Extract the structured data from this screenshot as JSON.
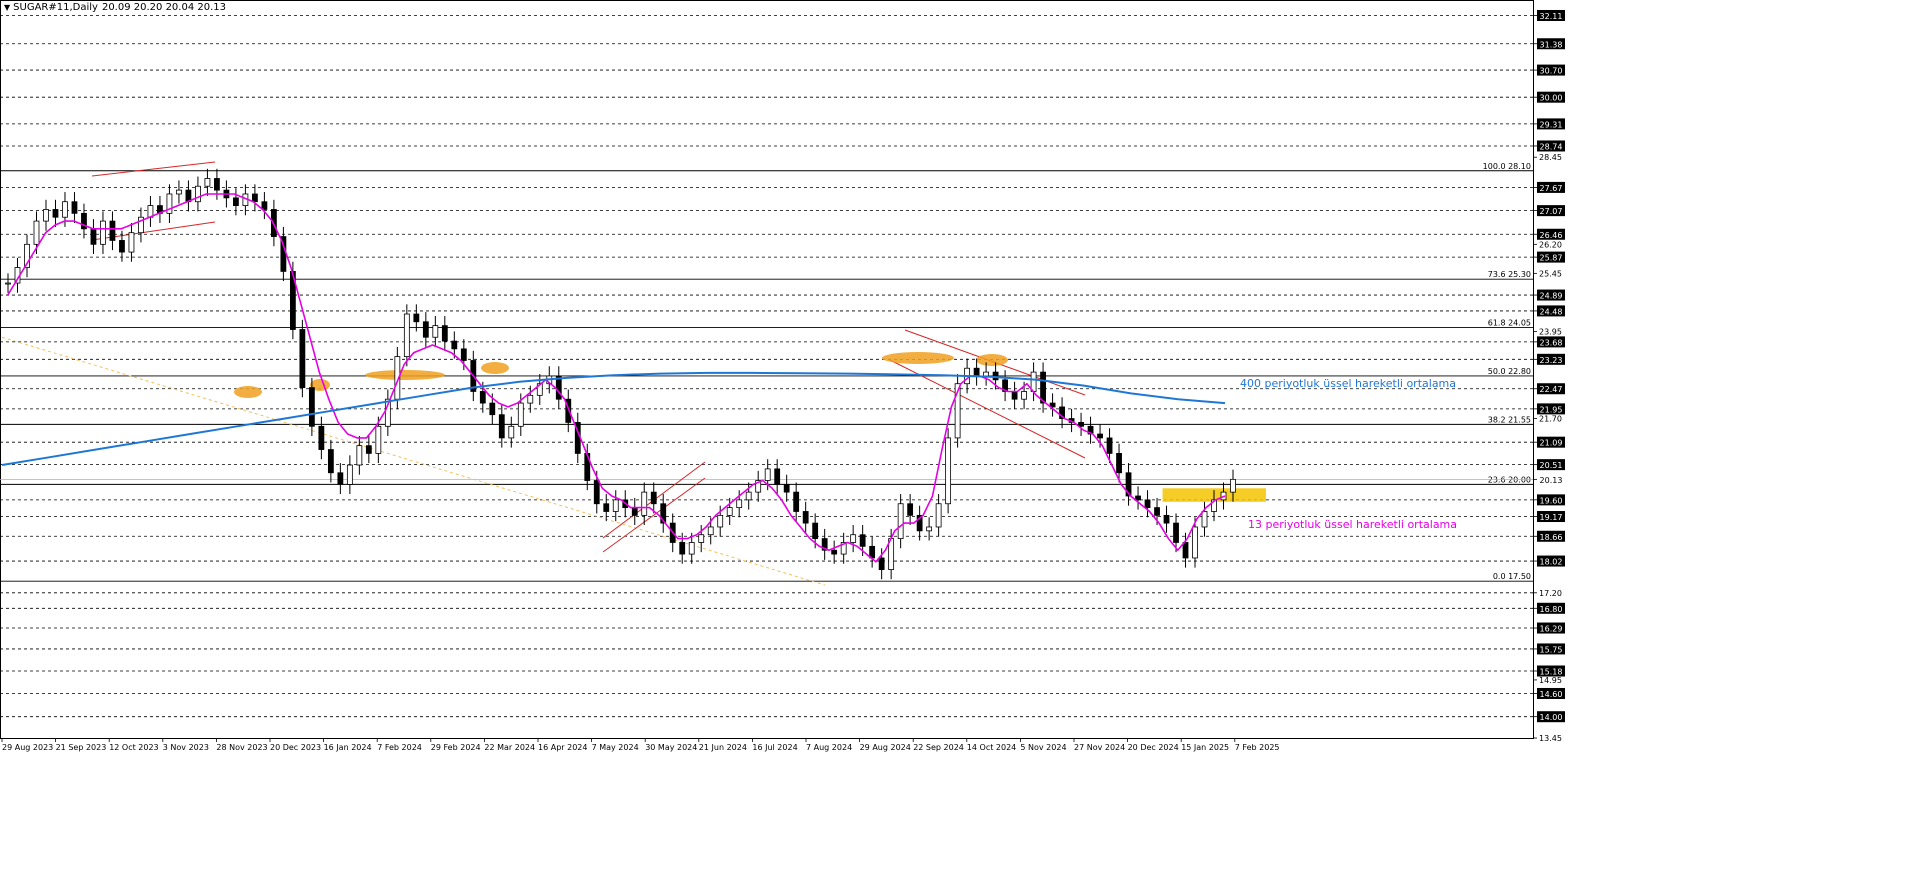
{
  "header": {
    "symbol": "SUGAR#11,Daily",
    "ohlc": "20.09 20.20 20.04 20.13"
  },
  "chart_data": {
    "type": "candlestick",
    "title": "SUGAR#11,Daily",
    "ylim": [
      13.45,
      32.2
    ],
    "y_ticks": [
      "32.11",
      "31.38",
      "30.70",
      "30.00",
      "29.31",
      "28.74",
      "28.45",
      "27.67",
      "27.07",
      "26.46",
      "26.20",
      "25.87",
      "25.45",
      "24.89",
      "24.48",
      "23.95",
      "23.68",
      "23.23",
      "22.47",
      "21.95",
      "21.70",
      "21.09",
      "20.51",
      "20.13",
      "19.60",
      "19.17",
      "18.66",
      "18.02",
      "17.20",
      "16.80",
      "16.29",
      "15.75",
      "15.18",
      "14.95",
      "14.60",
      "14.00",
      "13.45"
    ],
    "highlighted_levels": [
      32.11,
      31.38,
      30.7,
      30.0,
      29.31,
      28.74,
      27.67,
      27.07,
      26.46,
      25.87,
      24.89,
      24.48,
      23.68,
      23.23,
      22.47,
      21.95,
      21.09,
      20.51,
      20.13,
      19.6,
      19.17,
      18.66,
      18.02,
      16.8,
      16.29,
      15.75,
      15.18,
      14.6,
      14.0
    ],
    "plain_levels": [
      28.45,
      26.2,
      25.45,
      23.95,
      21.7,
      17.2,
      13.45
    ],
    "current_price": 20.13,
    "x_labels": [
      "29 Aug 2023",
      "21 Sep 2023",
      "12 Oct 2023",
      "3 Nov 2023",
      "28 Nov 2023",
      "20 Dec 2023",
      "16 Jan 2024",
      "7 Feb 2024",
      "29 Feb 2024",
      "22 Mar 2024",
      "16 Apr 2024",
      "7 May 2024",
      "30 May 2024",
      "21 Jun 2024",
      "16 Jul 2024",
      "7 Aug 2024",
      "29 Aug 2024",
      "22 Sep 2024",
      "14 Oct 2024",
      "5 Nov 2024",
      "27 Nov 2024",
      "20 Dec 2024",
      "15 Jan 2025",
      "7 Feb 2025"
    ],
    "dashed_levels": [
      32.11,
      31.38,
      30.7,
      30.0,
      29.31,
      28.74,
      27.67,
      27.07,
      26.46,
      25.87,
      24.89,
      24.48,
      23.68,
      23.23,
      22.47,
      21.95,
      21.09,
      20.51,
      19.6,
      19.17,
      18.66,
      18.02,
      17.2,
      16.8,
      16.29,
      15.75,
      15.18,
      14.6,
      14.0
    ],
    "fibonacci": [
      {
        "label": "100.0 28.10",
        "value": 28.1
      },
      {
        "label": "73.6 25.30",
        "value": 25.3
      },
      {
        "label": "61.8 24.05",
        "value": 24.05
      },
      {
        "label": "50.0 22.80",
        "value": 22.8
      },
      {
        "label": "38.2 21.55",
        "value": 21.55
      },
      {
        "label": "23.6 20.00",
        "value": 20.0
      },
      {
        "label": "0.0 17.50",
        "value": 17.5
      }
    ],
    "close_series": [
      25.2,
      25.6,
      26.2,
      26.8,
      27.1,
      26.9,
      27.3,
      27.0,
      26.6,
      26.2,
      26.8,
      26.3,
      26.0,
      26.5,
      26.9,
      27.2,
      27.0,
      27.5,
      27.6,
      27.3,
      27.7,
      27.9,
      27.6,
      27.4,
      27.2,
      27.5,
      27.3,
      27.1,
      26.4,
      25.5,
      24.0,
      22.5,
      21.5,
      20.9,
      20.3,
      20.0,
      20.5,
      21.0,
      20.8,
      21.5,
      22.2,
      23.3,
      24.4,
      24.2,
      23.8,
      24.1,
      23.7,
      23.5,
      23.2,
      22.4,
      22.1,
      21.8,
      21.2,
      21.5,
      22.1,
      22.3,
      22.6,
      22.8,
      22.2,
      21.6,
      20.8,
      20.1,
      19.5,
      19.3,
      19.6,
      19.4,
      19.2,
      19.8,
      19.5,
      19.0,
      18.5,
      18.2,
      18.5,
      18.7,
      18.9,
      19.2,
      19.4,
      19.6,
      19.8,
      20.1,
      20.4,
      20.0,
      19.8,
      19.3,
      19.0,
      18.6,
      18.3,
      18.2,
      18.5,
      18.7,
      18.4,
      18.1,
      17.8,
      18.6,
      19.5,
      19.2,
      18.8,
      18.9,
      19.5,
      21.2,
      22.6,
      23.0,
      22.8,
      22.9,
      22.7,
      22.4,
      22.2,
      22.4,
      22.9,
      22.1,
      22.0,
      21.7,
      21.6,
      21.5,
      21.3,
      21.2,
      20.8,
      20.3,
      19.7,
      19.6,
      19.4,
      19.2,
      19.0,
      18.5,
      18.1,
      18.9,
      19.3,
      19.6,
      19.8,
      20.13
    ],
    "series": [
      {
        "name": "13 periyotluk üssel hareketli ortalama",
        "color": "#e600e6",
        "values": [
          24.9,
          25.3,
          25.7,
          26.1,
          26.5,
          26.7,
          26.8,
          26.8,
          26.7,
          26.6,
          26.6,
          26.6,
          26.6,
          26.7,
          26.8,
          26.9,
          27.0,
          27.1,
          27.2,
          27.3,
          27.4,
          27.5,
          27.5,
          27.5,
          27.5,
          27.4,
          27.3,
          27.1,
          26.8,
          26.3,
          25.6,
          24.7,
          23.8,
          22.9,
          22.2,
          21.6,
          21.3,
          21.2,
          21.2,
          21.5,
          21.9,
          22.5,
          23.1,
          23.4,
          23.5,
          23.6,
          23.5,
          23.4,
          23.2,
          22.9,
          22.6,
          22.3,
          22.1,
          22.0,
          22.1,
          22.3,
          22.5,
          22.7,
          22.5,
          22.2,
          21.6,
          21.0,
          20.4,
          19.9,
          19.7,
          19.6,
          19.4,
          19.4,
          19.4,
          19.2,
          18.9,
          18.6,
          18.6,
          18.7,
          18.9,
          19.2,
          19.4,
          19.6,
          19.8,
          20.0,
          20.1,
          19.9,
          19.6,
          19.2,
          18.9,
          18.6,
          18.4,
          18.3,
          18.4,
          18.5,
          18.4,
          18.2,
          18.0,
          18.3,
          18.8,
          19.0,
          19.0,
          19.2,
          19.7,
          20.9,
          22.0,
          22.6,
          22.8,
          22.8,
          22.7,
          22.5,
          22.4,
          22.4,
          22.6,
          22.3,
          22.1,
          21.9,
          21.7,
          21.6,
          21.4,
          21.3,
          21.0,
          20.5,
          20.0,
          19.7,
          19.5,
          19.3,
          19.0,
          18.6,
          18.3,
          18.6,
          19.1,
          19.4,
          19.6,
          19.7
        ]
      },
      {
        "name": "400 periyotluk üssel hareketli ortalama",
        "color": "#1f77d4",
        "values": [
          20.5,
          20.7,
          20.9,
          21.1,
          21.3,
          21.5,
          21.7,
          21.9,
          22.1,
          22.3,
          22.5,
          22.65,
          22.75,
          22.82,
          22.86,
          22.88,
          22.88,
          22.87,
          22.86,
          22.84,
          22.82,
          22.78,
          22.7,
          22.55,
          22.35,
          22.2,
          22.1
        ]
      }
    ],
    "annotations": [
      {
        "text": "400 periyotluk üssel hareketli ortalama",
        "color": "#1f77d4"
      },
      {
        "text": "13 periyotluk üssel hareketli ortalama",
        "color": "#e600e6"
      }
    ],
    "zones": [
      {
        "type": "support-resistance",
        "color": "#f5c400",
        "from": 19.55,
        "to": 19.9
      }
    ],
    "colors": {
      "candle": "#000000",
      "fib_line": "#000000",
      "trend_channel": "#d62728",
      "dotted_trend": "#f0c060",
      "highlight_marks": "#f0a020"
    },
    "grid": false
  }
}
